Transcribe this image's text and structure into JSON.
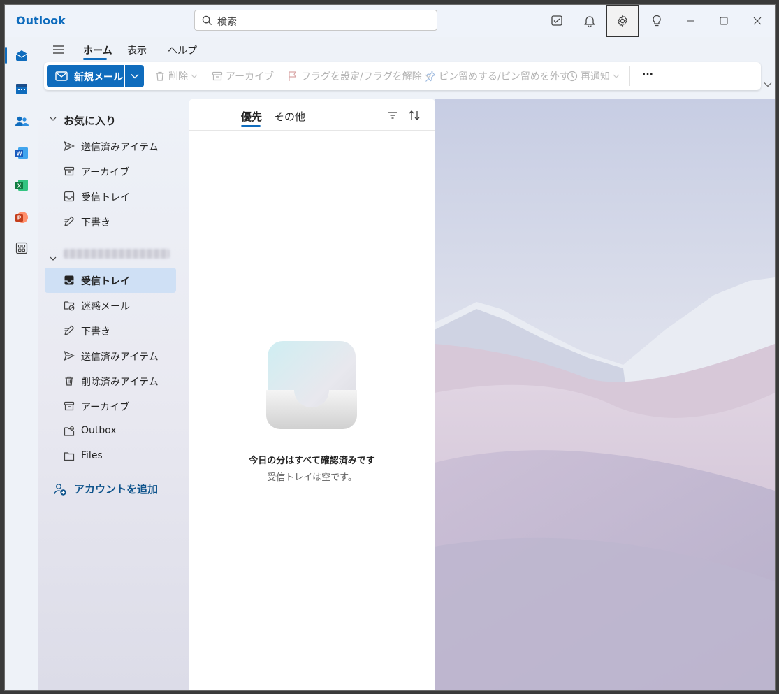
{
  "app": {
    "title": "Outlook"
  },
  "search": {
    "placeholder": "検索"
  },
  "ribbon": {
    "tabs": [
      {
        "label": "ホーム"
      },
      {
        "label": "表示"
      },
      {
        "label": "ヘルプ"
      }
    ],
    "new_mail": "新規メール",
    "delete": "削除",
    "archive": "アーカイブ",
    "flag": "フラグを設定/フラグを解除",
    "pin": "ピン留めする/ピン留めを外す",
    "snooze": "再通知",
    "more": "···"
  },
  "favorites": {
    "header": "お気に入り",
    "items": [
      {
        "label": "送信済みアイテム"
      },
      {
        "label": "アーカイブ"
      },
      {
        "label": "受信トレイ"
      },
      {
        "label": "下書き"
      }
    ]
  },
  "account": {
    "items": [
      {
        "label": "受信トレイ"
      },
      {
        "label": "迷惑メール"
      },
      {
        "label": "下書き"
      },
      {
        "label": "送信済みアイテム"
      },
      {
        "label": "削除済みアイテム"
      },
      {
        "label": "アーカイブ"
      },
      {
        "label": "Outbox"
      },
      {
        "label": "Files"
      }
    ],
    "add_account": "アカウントを追加"
  },
  "message_list": {
    "pivots": [
      {
        "label": "優先"
      },
      {
        "label": "その他"
      }
    ],
    "empty_title": "今日の分はすべて確認済みです",
    "empty_subtitle": "受信トレイは空です。"
  },
  "colors": {
    "accent": "#0f6cbd",
    "selected_folder": "#cfe0f5"
  }
}
